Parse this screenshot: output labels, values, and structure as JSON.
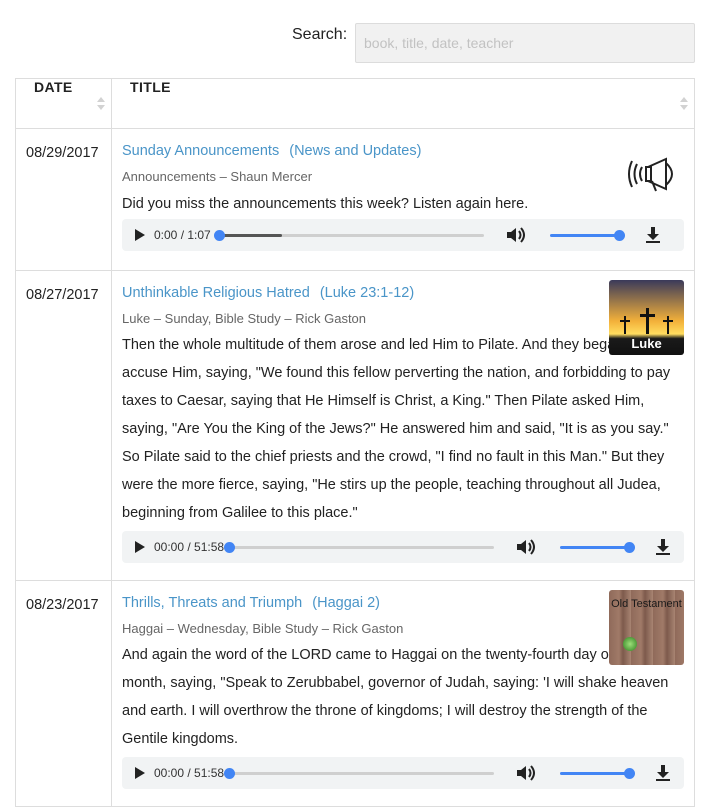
{
  "search": {
    "label": "Search:",
    "placeholder": "book, title, date, teacher",
    "value": ""
  },
  "table": {
    "columns": [
      {
        "label": "DATE"
      },
      {
        "label": "TITLE"
      }
    ],
    "rows": [
      {
        "date": "08/29/2017",
        "title": "Sunday Announcements",
        "passage": "(News and Updates)",
        "meta": "Announcements – Shaun Mercer",
        "description": "Did you miss the announcements this week? Listen again here.",
        "thumbnail_icon": "megaphone-icon",
        "player": {
          "time": "0:00 / 1:07",
          "progress": 0.0,
          "buffered": 0.24,
          "volume": 1.0
        }
      },
      {
        "date": "08/27/2017",
        "title": "Unthinkable Religious Hatred",
        "passage": "(Luke 23:1-12)",
        "meta": "Luke – Sunday, Bible Study – Rick Gaston",
        "description": "Then the whole multitude of them arose and led Him to Pilate. And they began to accuse Him, saying, \"We found this fellow perverting the nation, and forbidding to pay taxes to Caesar, saying that He Himself is Christ, a King.\" Then Pilate asked Him, saying, \"Are You the King of the Jews?\" He answered him and said, \"It is as you say.\" So Pilate said to the chief priests and the crowd, \"I find no fault in this Man.\" But they were the more fierce, saying, \"He stirs up the people, teaching throughout all Judea, beginning from Galilee to this place.\"",
        "thumbnail_label": "Luke",
        "player": {
          "time": "00:00 / 51:58",
          "progress": 0.0,
          "buffered": 0.0,
          "volume": 1.0
        }
      },
      {
        "date": "08/23/2017",
        "title": "Thrills, Threats and Triumph",
        "passage": "(Haggai 2)",
        "meta": "Haggai – Wednesday, Bible Study – Rick Gaston",
        "description": "And again the word of the LORD came to Haggai on the twenty-fourth day of the month, saying, \"Speak to Zerubbabel, governor of Judah, saying: 'I will shake heaven and earth. I will overthrow the throne of kingdoms; I will destroy the strength of the Gentile kingdoms.",
        "thumbnail_label": "Old Testament",
        "player": {
          "time": "00:00 / 51:58",
          "progress": 0.0,
          "buffered": 0.0,
          "volume": 1.0
        }
      }
    ]
  },
  "icons": {
    "play": "play-icon",
    "volume": "volume-icon",
    "download": "download-icon",
    "sort": "sort-icon"
  },
  "colors": {
    "link": "#4a95c8",
    "accent": "#4285f4",
    "player_bg": "#f1f3f4"
  }
}
